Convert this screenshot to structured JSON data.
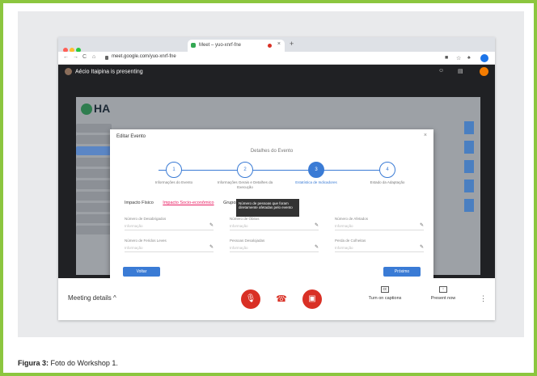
{
  "browser": {
    "tab_title": "Meet – yuo-xnrf-fne",
    "new_tab": "+",
    "url": "meet.google.com/yuo-xnrf-fne",
    "nav": [
      "←",
      "→",
      "C",
      "⌂"
    ]
  },
  "meet": {
    "presenting": "Aécio Itaipina is presenting",
    "meeting_details": "Meeting details",
    "captions_label": "Turn on captions",
    "present_label": "Present now"
  },
  "app": {
    "logo": "HA"
  },
  "modal": {
    "title": "Editar Evento",
    "subtitle": "Detalhes do Evento",
    "steps": [
      {
        "num": "1",
        "label": "Informações do Evento"
      },
      {
        "num": "2",
        "label": "Informações Gerais e Detalhes da Execução"
      },
      {
        "num": "3",
        "label": "Estatística de Indicadores"
      },
      {
        "num": "4",
        "label": "Estado da Adaptação"
      }
    ],
    "tabs": [
      "Impacto Físico",
      "Impacto Socio-econômico",
      "Grupos Vulneráveis"
    ],
    "tooltip": "Número de pessoas que foram diretamente afetadas pelo evento",
    "fields": [
      {
        "label": "Número de Desabrigados",
        "value": "Informação"
      },
      {
        "label": "Número de Óbitos",
        "value": "Informação"
      },
      {
        "label": "Número de Afetados",
        "value": "Informação"
      },
      {
        "label": "Número de Feridos Leves",
        "value": "Informação"
      },
      {
        "label": "Pessoas Desalojadas",
        "value": "Informação"
      },
      {
        "label": "Perda de Colheitas",
        "value": "Informação"
      }
    ],
    "back_button": "Voltar",
    "next_button": "Próximo"
  },
  "caption": {
    "prefix": "Figura 3:",
    "text": "Foto do Workshop 1."
  },
  "colors": {
    "frame": "#8cc63f",
    "accent": "#3a7bd5",
    "meet_red": "#d93025"
  }
}
